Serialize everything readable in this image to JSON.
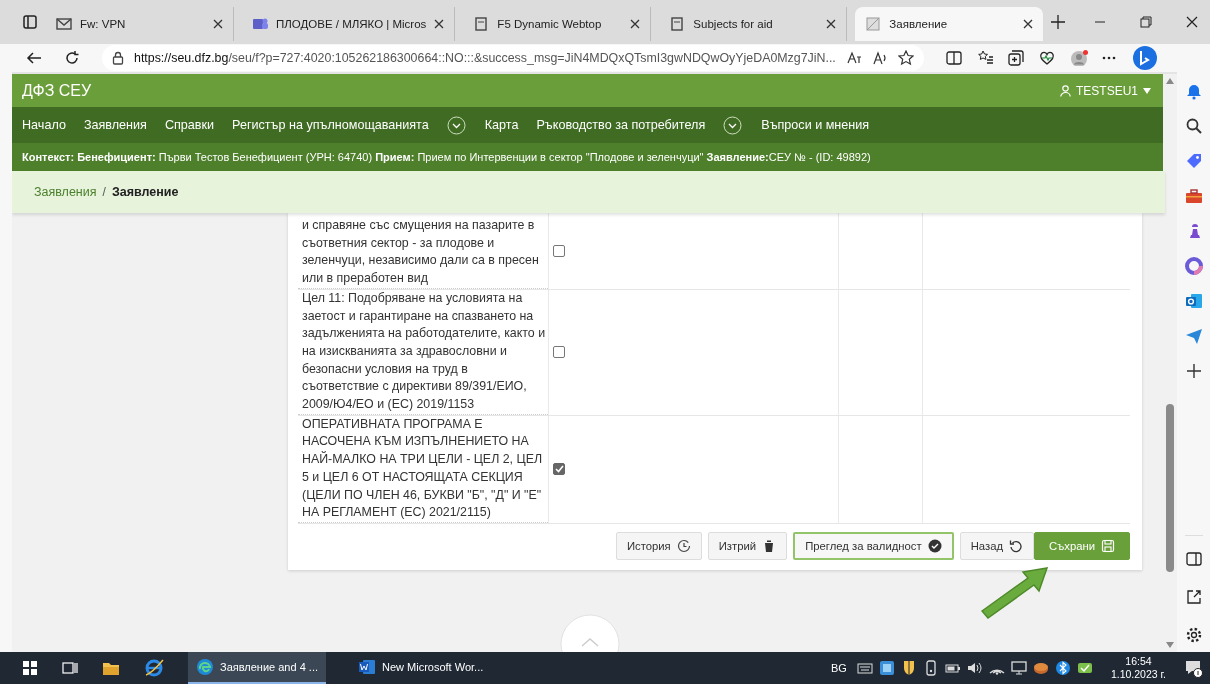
{
  "browser": {
    "tabs": [
      {
        "title": "Fw: VPN",
        "selected": false
      },
      {
        "title": "ПЛОДОВЕ / МЛЯКО | Micros",
        "selected": false
      },
      {
        "title": "F5 Dynamic Webtop",
        "selected": false
      },
      {
        "title": "Subjects for aid",
        "selected": false
      },
      {
        "title": "Заявление",
        "selected": true
      }
    ],
    "url_host": "https://seu.dfz.bg",
    "url_rest": "/seu/f?p=727:4020:105262186300664::NO:::&success_msg=JiN4MDQxQTsmI3gwNDQwOyYjeDA0Mzg7JiN..."
  },
  "header": {
    "title": "ДФЗ СЕУ",
    "user": "TESTSEU1"
  },
  "nav": [
    {
      "label": "Начало",
      "dropdown": false
    },
    {
      "label": "Заявления",
      "dropdown": false
    },
    {
      "label": "Справки",
      "dropdown": false
    },
    {
      "label": "Регистър на упълномощаванията",
      "dropdown": true
    },
    {
      "label": "Карта",
      "dropdown": false
    },
    {
      "label": "Ръководство за потребителя",
      "dropdown": true
    },
    {
      "label": "Въпроси и мнения",
      "dropdown": false
    }
  ],
  "context": "**Контекст: Бенефициент:** Първи Тестов Бенефициент (УРН: 64740) **Прием:** Прием по Интервенции в сектор \"Плодове и зеленчуци\" **Заявление:**СЕУ № - (ID: 49892)",
  "breadcrumb": {
    "separator": "/",
    "items": [
      {
        "label": "Заявления",
        "current": false
      },
      {
        "label": "Заявление",
        "current": true
      }
    ]
  },
  "rows": [
    {
      "text": "и справяне със смущения на пазарите в съответния сектор - за плодове и зеленчуци, независимо дали са в пресен или в преработен вид",
      "checked": false
    },
    {
      "text": "Цел 11: Подобряване на условията на заетост и гарантиране на спазването на задълженията на работодателите, както и на изискванията за здравословни и безопасни условия на труд в съответствие с директиви 89/391/ЕИО, 2009/Ю4/ЕО и (ЕС) 2019/1153",
      "checked": false
    },
    {
      "text": "ОПЕРАТИВНАТА ПРОГРАМА Е НАСОЧЕНА КЪМ ИЗПЪЛНЕНИЕТО НА НАЙ-МАЛКО НА ТРИ ЦЕЛИ - ЦЕЛ 2, ЦЕЛ 5 и ЦЕЛ 6 ОТ НАСТОЯЩАТА СЕКЦИЯ (ЦЕЛИ ПО ЧЛЕН 46, БУКВИ \"Б\", \"Д\" И \"Е\" НА РЕГЛАМЕНТ (ЕС) 2021/2115)",
      "checked": true
    }
  ],
  "buttons": [
    {
      "label": "История",
      "kind": "default"
    },
    {
      "label": "Изтрий",
      "kind": "default"
    },
    {
      "label": "Преглед за валидност",
      "kind": "outline"
    },
    {
      "label": "Назад",
      "kind": "default"
    },
    {
      "label": "Съхрани",
      "kind": "primary"
    }
  ],
  "taskbar": {
    "apps": [
      {
        "label": "Заявление and 4 ...",
        "selected": true
      },
      {
        "label": "New Microsoft Wor...",
        "selected": false
      }
    ],
    "language": "BG",
    "time": "16:54",
    "date": "1.10.2023 г."
  }
}
